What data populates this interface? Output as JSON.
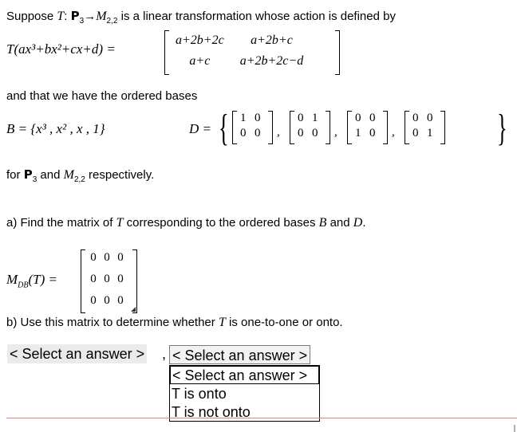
{
  "problem": {
    "intro_prefix": "Suppose ",
    "intro_T": "T",
    "intro_colon": ": ",
    "intro_space": "P",
    "intro_space_sub": "3",
    "intro_arrow": "→",
    "intro_target": "M",
    "intro_target_sub": "2,2",
    "intro_suffix": " is a linear transformation whose action is defined by",
    "lhs": "T(ax³+bx²+cx+d) =",
    "matrix": [
      [
        "a+2b+2c",
        "a+2b+c"
      ],
      [
        "a+c",
        "a+2b+2c−d"
      ]
    ],
    "bases_text": "and that we have the ordered bases",
    "basis_B": "B = {x³ , x² , x , 1}",
    "basis_D_label": "D =",
    "basis_D_matrices": [
      [
        [
          "1",
          "0"
        ],
        [
          "0",
          "0"
        ]
      ],
      [
        [
          "0",
          "1"
        ],
        [
          "0",
          "0"
        ]
      ],
      [
        [
          "0",
          "0"
        ],
        [
          "1",
          "0"
        ]
      ],
      [
        [
          "0",
          "0"
        ],
        [
          "0",
          "1"
        ]
      ]
    ],
    "for_prefix": "for ",
    "for_space": "P",
    "for_space_sub": "3",
    "for_and": " and ",
    "for_target": "M",
    "for_target_sub": "2,2",
    "for_suffix": " respectively.",
    "part_a_prefix": "a) Find the matrix of ",
    "part_a_T": "T",
    "part_a_mid": " corresponding to the ordered bases ",
    "part_a_B": "B",
    "part_a_and": " and ",
    "part_a_D": "D",
    "part_a_end": ".",
    "answer_label": "M",
    "answer_label_sub": "DB",
    "answer_label_rest": "(T) =",
    "answer_matrix": [
      [
        "0",
        "0",
        "0"
      ],
      [
        "0",
        "0",
        "0"
      ],
      [
        "0",
        "0",
        "0"
      ]
    ],
    "part_b_prefix": "b) Use this matrix to determine whether ",
    "part_b_T": "T",
    "part_b_suffix": " is one-to-one or onto."
  },
  "selects": {
    "first_value": "< Select an answer >",
    "separator": ",",
    "second_value": "< Select an answer >",
    "options": [
      "< Select an answer >",
      "T is onto",
      "T is not onto"
    ]
  },
  "colors": {
    "accent_line": "#e87a7a",
    "select_bg": "#ebebeb"
  }
}
